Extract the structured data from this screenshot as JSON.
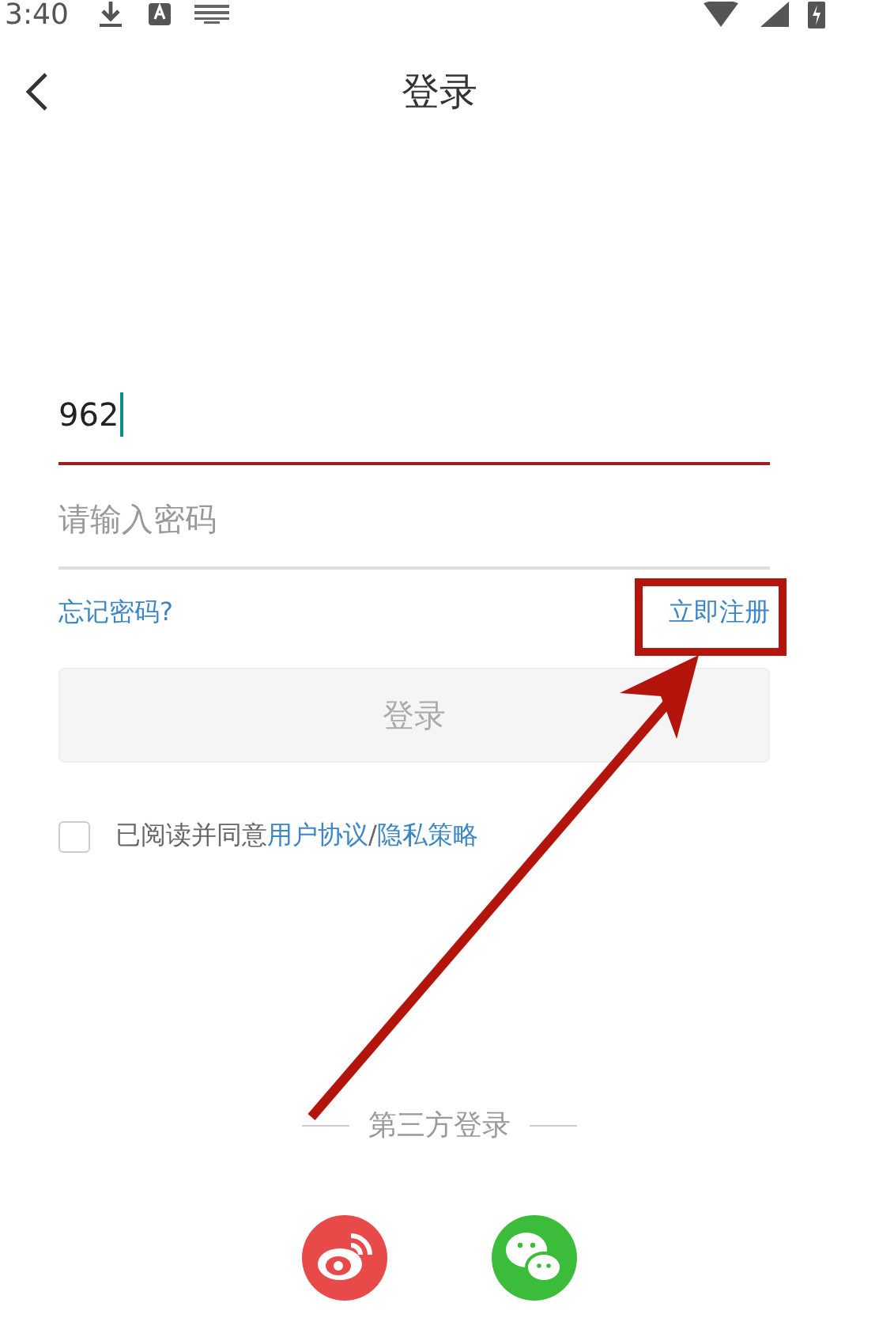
{
  "status_bar": {
    "time": "3:40"
  },
  "header": {
    "title": "登录"
  },
  "phone_field": {
    "value": "962",
    "focused": true
  },
  "password_field": {
    "placeholder": "请输入密码"
  },
  "links": {
    "forgot": "忘记密码?",
    "register": "立即注册"
  },
  "login_button": {
    "label": "登录",
    "disabled": true
  },
  "agreement": {
    "checked": false,
    "parts": [
      {
        "text": "已阅读并同意",
        "kind": "plain"
      },
      {
        "text": "用户协议",
        "kind": "link"
      },
      {
        "text": "/",
        "kind": "plain"
      },
      {
        "text": "隐私策略",
        "kind": "link"
      }
    ]
  },
  "third_party": {
    "label": "第三方登录",
    "providers": [
      {
        "kind": "swirl"
      },
      {
        "kind": "chat"
      }
    ]
  },
  "annotation": {
    "shown": true
  }
}
